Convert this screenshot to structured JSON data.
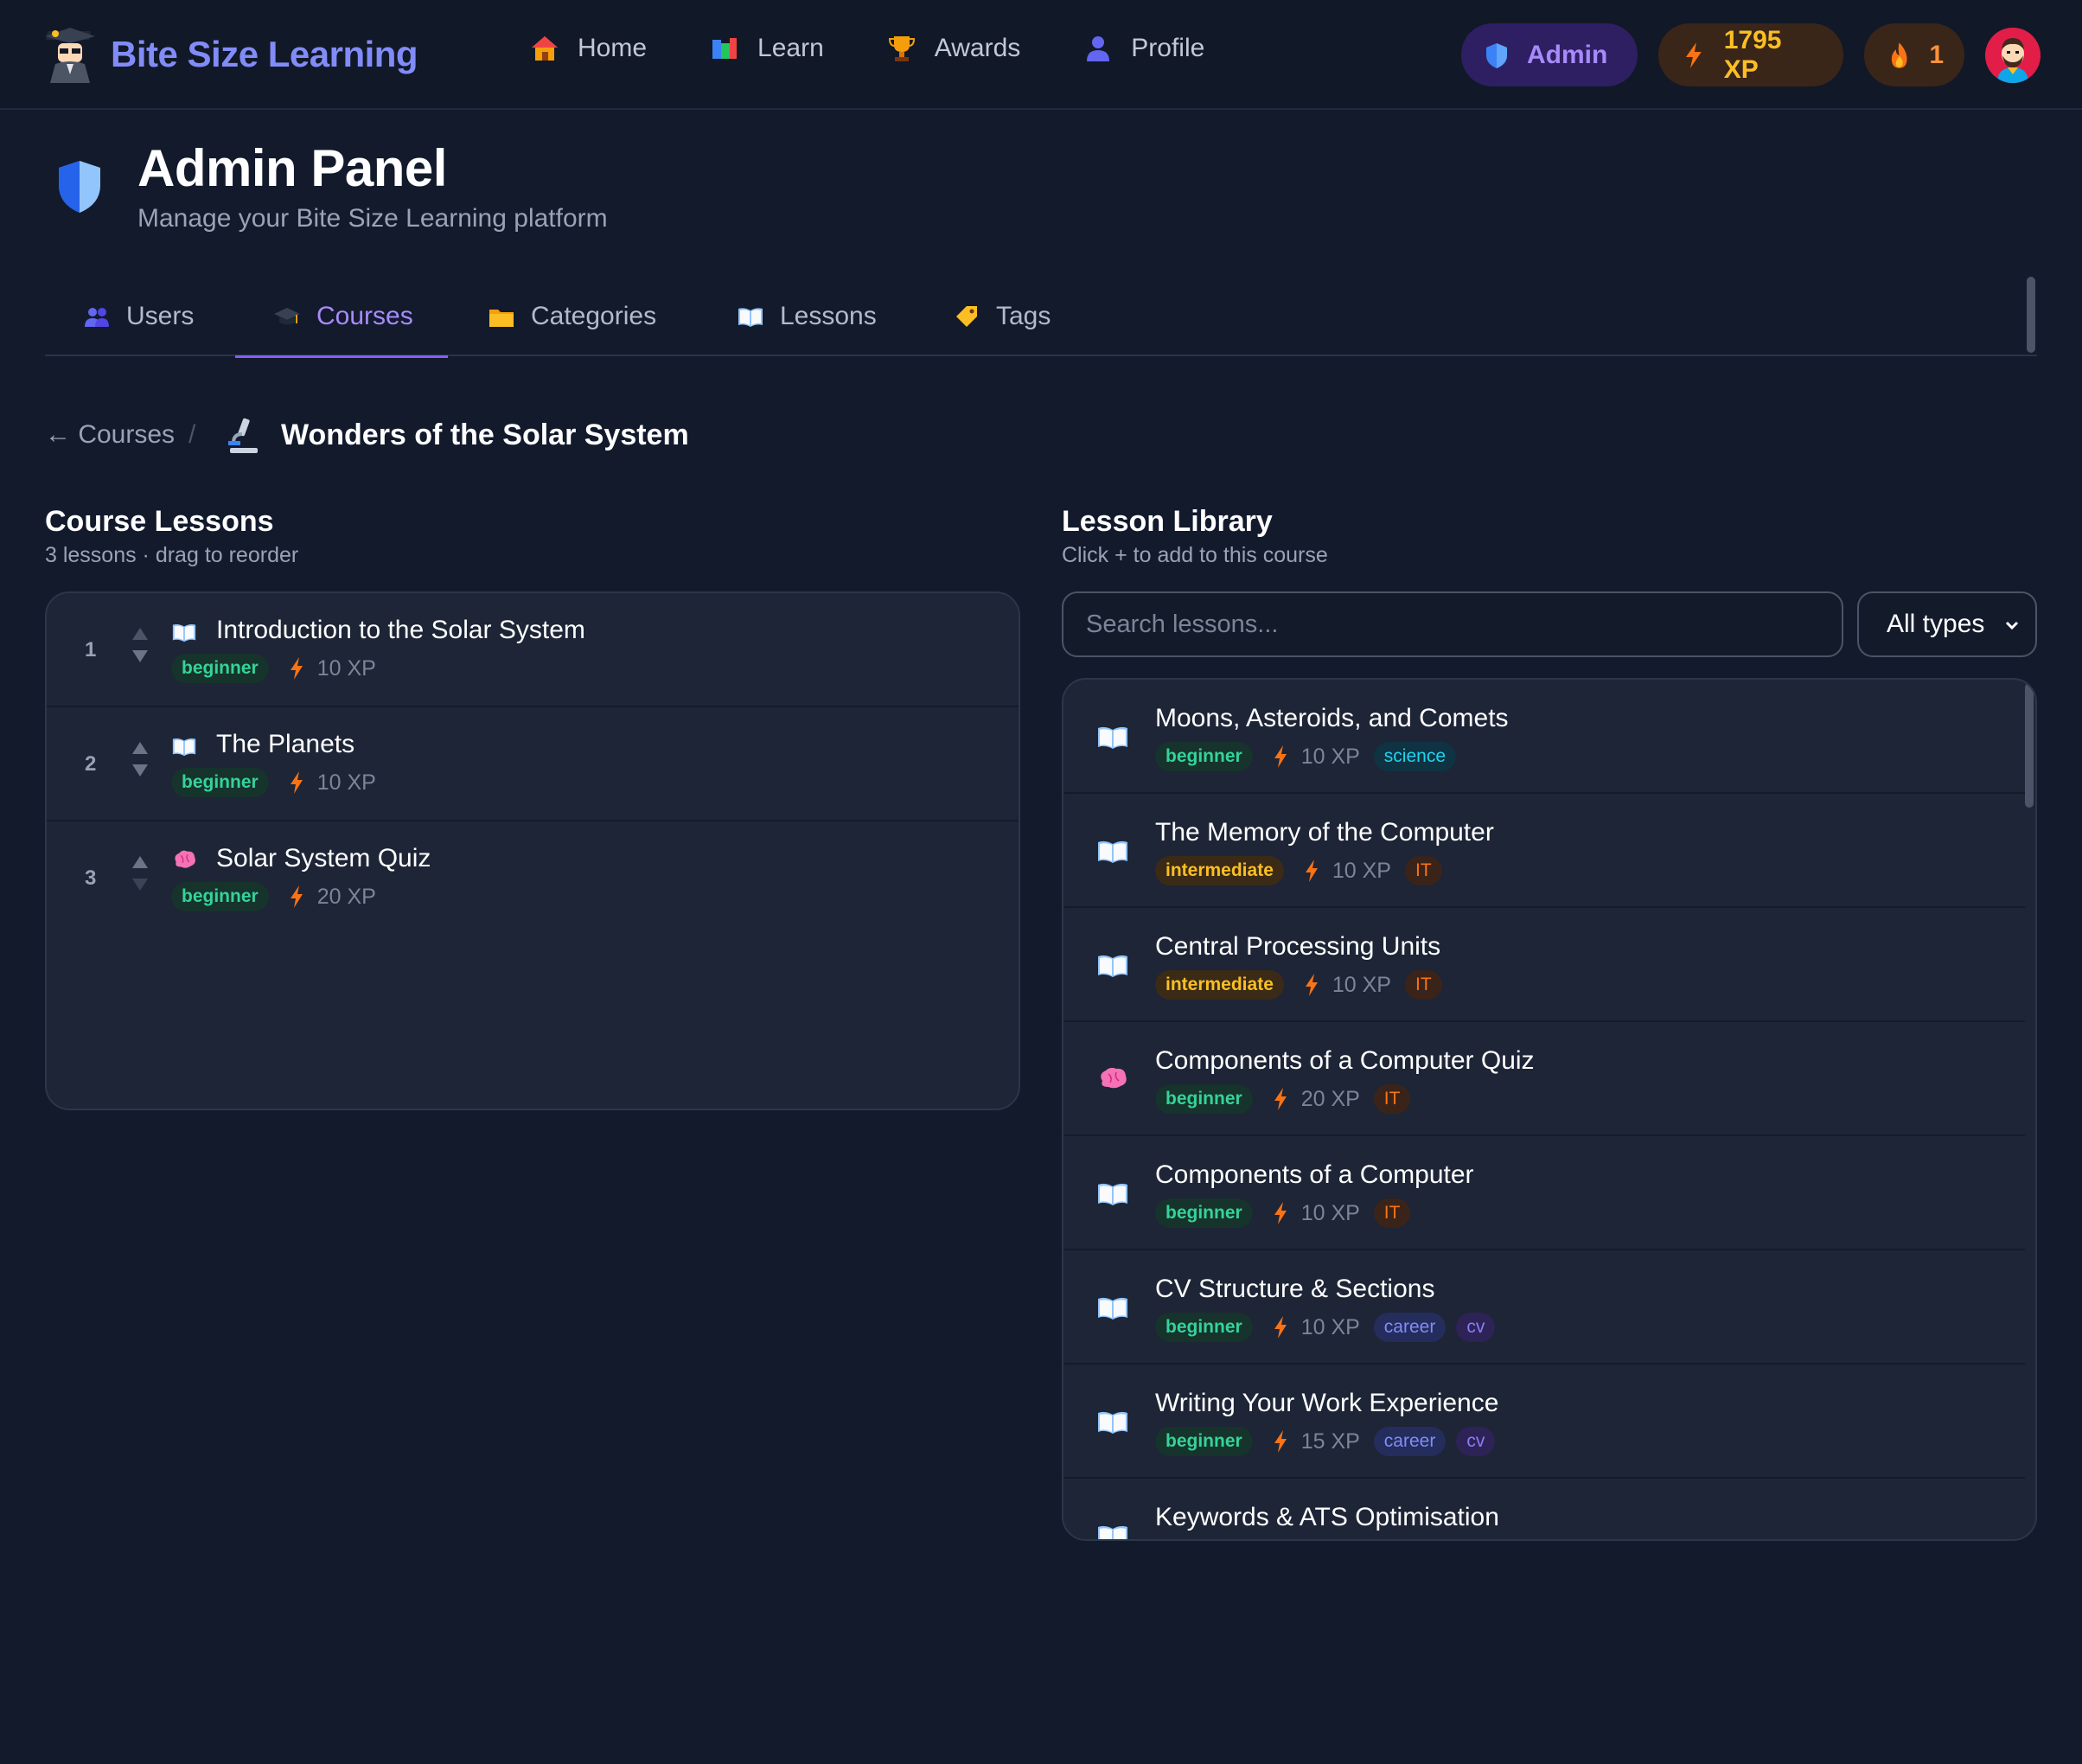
{
  "app": {
    "name": "Bite Size Learning"
  },
  "nav": {
    "items": [
      {
        "label": "Home",
        "icon": "house-icon"
      },
      {
        "label": "Learn",
        "icon": "books-icon"
      },
      {
        "label": "Awards",
        "icon": "trophy-icon"
      },
      {
        "label": "Profile",
        "icon": "user-icon"
      }
    ],
    "admin_label": "Admin",
    "xp_label": "1795 XP",
    "streak_label": "1"
  },
  "header": {
    "title": "Admin Panel",
    "subtitle": "Manage your Bite Size Learning platform"
  },
  "tabs": [
    {
      "label": "Users",
      "icon": "users-icon"
    },
    {
      "label": "Courses",
      "icon": "graduation-cap-icon",
      "active": true
    },
    {
      "label": "Categories",
      "icon": "folder-icon"
    },
    {
      "label": "Lessons",
      "icon": "book-icon"
    },
    {
      "label": "Tags",
      "icon": "tag-icon"
    }
  ],
  "breadcrumb": {
    "back": "← Courses",
    "separator": "/",
    "current": "Wonders of the Solar System",
    "icon": "microscope-icon"
  },
  "course_lessons": {
    "title": "Course Lessons",
    "subtitle": "3 lessons · drag to reorder",
    "items": [
      {
        "num": "1",
        "title": "Introduction to the Solar System",
        "type": "book",
        "level": "beginner",
        "xp": "10 XP"
      },
      {
        "num": "2",
        "title": "The Planets",
        "type": "book",
        "level": "beginner",
        "xp": "10 XP"
      },
      {
        "num": "3",
        "title": "Solar System Quiz",
        "type": "brain",
        "level": "beginner",
        "xp": "20 XP"
      }
    ]
  },
  "library": {
    "title": "Lesson Library",
    "subtitle": "Click + to add to this course",
    "search_placeholder": "Search lessons...",
    "filter_value": "All types",
    "items": [
      {
        "title": "Moons, Asteroids, and Comets",
        "type": "book",
        "level": "beginner",
        "xp": "10 XP",
        "tags": [
          "science"
        ]
      },
      {
        "title": "The Memory of the Computer",
        "type": "book",
        "level": "intermediate",
        "xp": "10 XP",
        "tags": [
          "IT"
        ]
      },
      {
        "title": "Central Processing Units",
        "type": "book",
        "level": "intermediate",
        "xp": "10 XP",
        "tags": [
          "IT"
        ]
      },
      {
        "title": "Components of a Computer Quiz",
        "type": "brain",
        "level": "beginner",
        "xp": "20 XP",
        "tags": [
          "IT"
        ]
      },
      {
        "title": "Components of a Computer",
        "type": "book",
        "level": "beginner",
        "xp": "10 XP",
        "tags": [
          "IT"
        ]
      },
      {
        "title": "CV Structure & Sections",
        "type": "book",
        "level": "beginner",
        "xp": "10 XP",
        "tags": [
          "career",
          "cv"
        ]
      },
      {
        "title": "Writing Your Work Experience",
        "type": "book",
        "level": "beginner",
        "xp": "15 XP",
        "tags": [
          "career",
          "cv"
        ]
      },
      {
        "title": "Keywords & ATS Optimisation",
        "type": "book",
        "level": "",
        "xp": "",
        "tags": []
      }
    ]
  },
  "colors": {
    "background": "#121a2c",
    "accent": "#818cf8",
    "active_tab": "#a78bfa",
    "xp": "#fbbf24",
    "beginner": "#34d399",
    "intermediate": "#fbbf24"
  }
}
